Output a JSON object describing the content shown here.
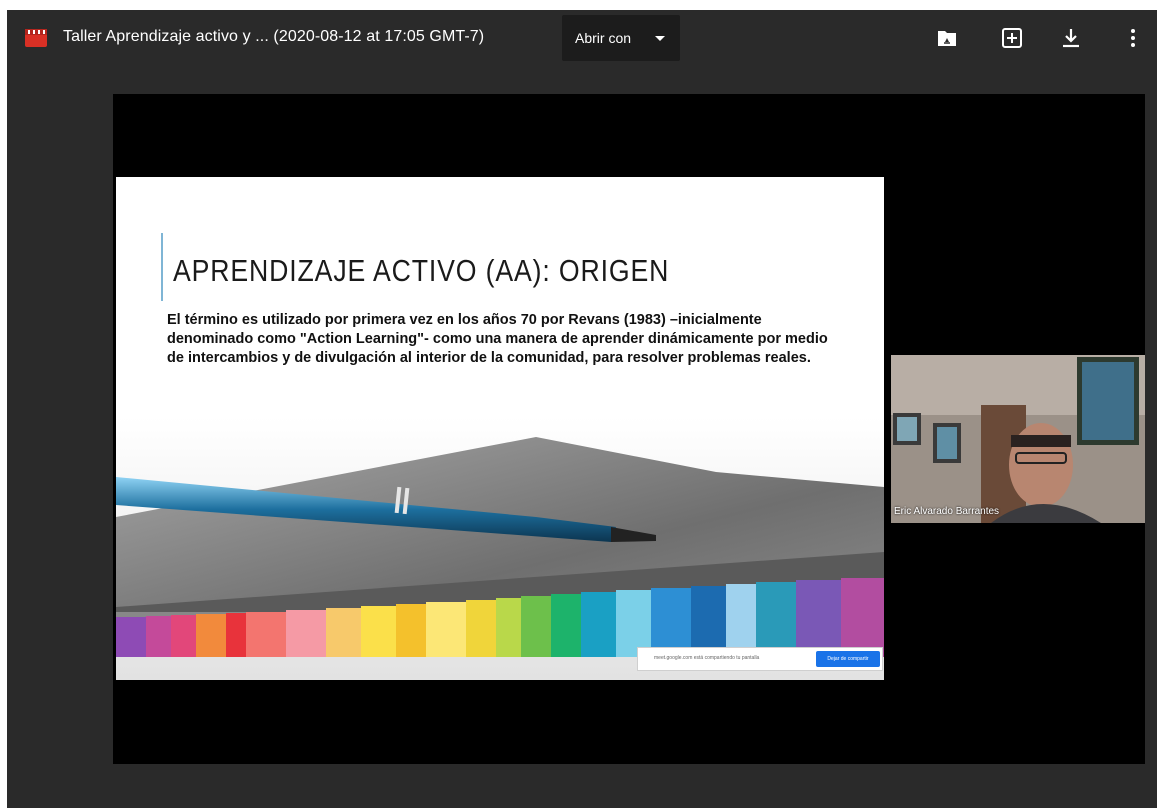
{
  "header": {
    "title": "Taller Aprendizaje activo y ... (2020-08-12 at 17:05 GMT-7)",
    "open_with_label": "Abrir con",
    "icons": [
      "video-file-icon",
      "add-to-drive-icon",
      "add-to-folder-icon",
      "download-icon",
      "more-vert-icon"
    ]
  },
  "slide": {
    "title": "APRENDIZAJE ACTIVO (AA): ORIGEN",
    "body_line1": "El término es utilizado por primera vez en los años 70 por Revans (1983) –inicialmente",
    "body_line2": "denominado como \"Action Learning\"- como una manera de aprender dinámicamente por medio",
    "body_line3": "de intercambios y de divulgación al interior de la comunidad, para resolver problemas reales.",
    "share_text": "meet.google.com está compartiendo tu pantalla",
    "share_button": "Dejar de compartir"
  },
  "participant": {
    "name": "Eric Alvarado Barrantes"
  },
  "colors": {
    "viewer_bg": "#2a2a2a",
    "file_icon": "#d93025",
    "accent_bar": "#7fb5d5",
    "share_button": "#1a73e8"
  }
}
